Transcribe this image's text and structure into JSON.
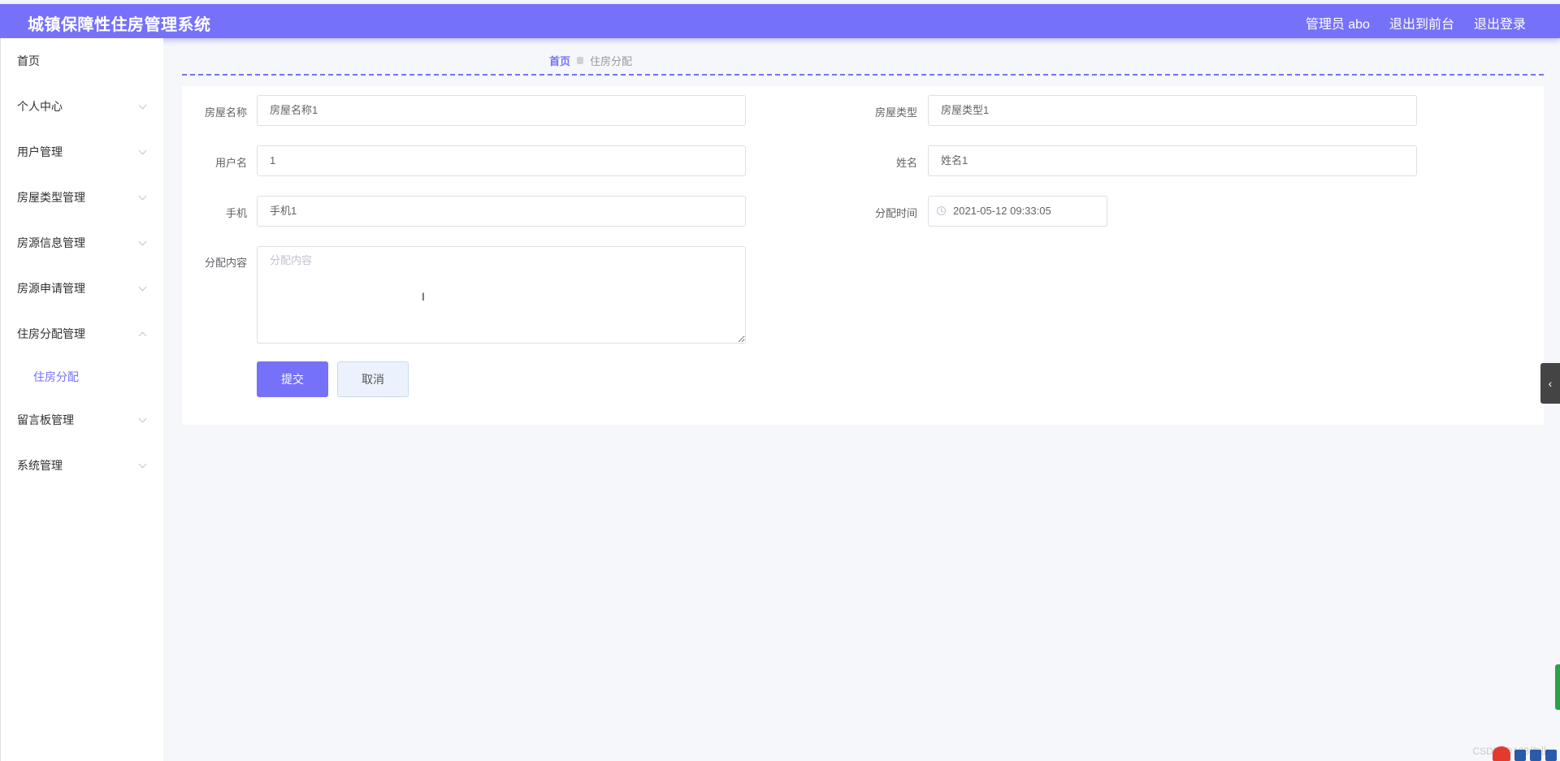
{
  "header": {
    "title": "城镇保障性住房管理系统",
    "admin_label": "管理员 abo",
    "to_front_label": "退出到前台",
    "logout_label": "退出登录",
    "accent_color": "#7571f9"
  },
  "sidebar": {
    "items": [
      {
        "label": "首页"
      },
      {
        "label": "个人中心"
      },
      {
        "label": "用户管理"
      },
      {
        "label": "房屋类型管理"
      },
      {
        "label": "房源信息管理"
      },
      {
        "label": "房源申请管理"
      },
      {
        "label": "住房分配管理"
      },
      {
        "label": "住房分配"
      },
      {
        "label": "留言板管理"
      },
      {
        "label": "系统管理"
      }
    ]
  },
  "breadcrumb": {
    "home": "首页",
    "current": "住房分配"
  },
  "form": {
    "house_name": {
      "label": "房屋名称",
      "value": "房屋名称1"
    },
    "house_type": {
      "label": "房屋类型",
      "value": "房屋类型1"
    },
    "username": {
      "label": "用户名",
      "value": "1"
    },
    "name": {
      "label": "姓名",
      "value": "姓名1"
    },
    "phone": {
      "label": "手机",
      "value": "手机1"
    },
    "assign_time": {
      "label": "分配时间",
      "value": "2021-05-12 09:33:05"
    },
    "content": {
      "label": "分配内容",
      "placeholder": "分配内容"
    },
    "submit_label": "提交",
    "cancel_label": "取消"
  },
  "footer": {
    "watermark": "CSDN @123作业"
  },
  "icons": {
    "collapse_toggle": "chevron-left-icon",
    "datetime": "clock-icon",
    "menu_expand": "chevron-down-icon"
  }
}
